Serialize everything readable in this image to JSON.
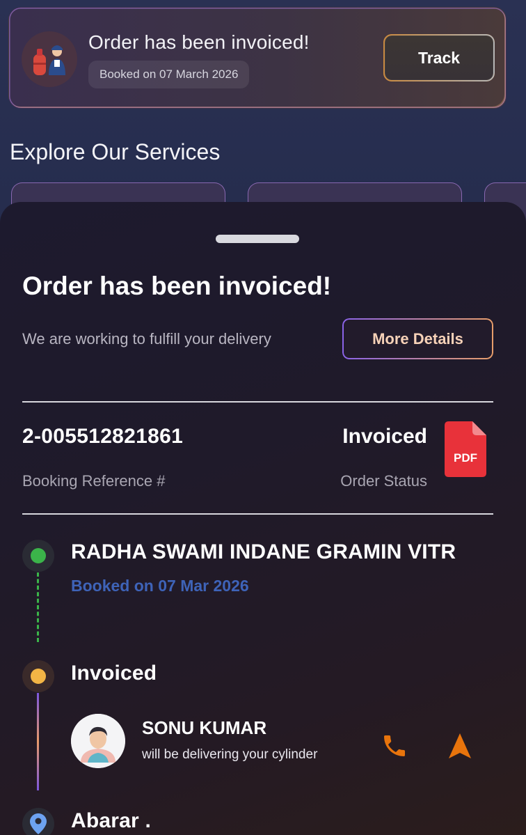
{
  "top_card": {
    "title": "Order has been invoiced!",
    "booked": "Booked on 07 March 2026",
    "track_label": "Track"
  },
  "services": {
    "title": "Explore Our Services"
  },
  "sheet": {
    "title": "Order has been invoiced!",
    "subtitle": "We are working to fulfill your delivery",
    "more_details_label": "More Details",
    "booking_reference": "2-005512821861",
    "booking_reference_label": "Booking Reference #",
    "order_status": "Invoiced",
    "order_status_label": "Order Status",
    "pdf_label": "PDF"
  },
  "timeline": {
    "distributor": "RADHA SWAMI INDANE GRAMIN VITR",
    "distributor_booked": "Booked on 07 Mar 2026",
    "status_step": "Invoiced",
    "agent_name": "SONU KUMAR",
    "agent_sub": "will be delivering your cylinder",
    "destination": "Abarar ."
  },
  "colors": {
    "accent_orange": "#e8740c",
    "dot_green": "#3bb44a",
    "dot_yellow": "#f3b545",
    "booked_blue": "#3e63b8"
  },
  "icons": [
    "gas-cylinder-illustration",
    "pdf-icon",
    "phone-icon",
    "navigation-arrow-icon",
    "location-pin-icon"
  ]
}
